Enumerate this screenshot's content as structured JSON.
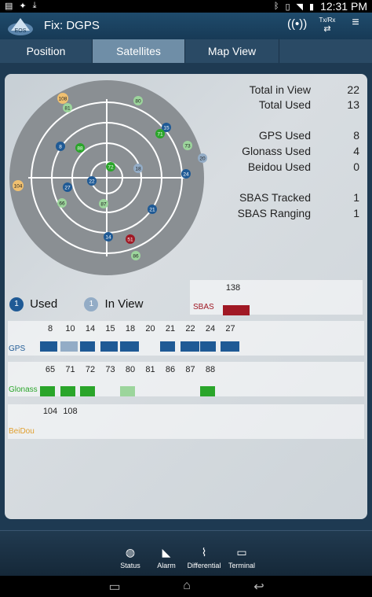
{
  "status_bar": {
    "time": "12:31 PM",
    "icons": [
      "notification-icon",
      "satellite-icon",
      "download-icon",
      "bluetooth-icon",
      "vibrate-icon",
      "wifi-icon",
      "battery-icon"
    ]
  },
  "action_bar": {
    "title": "Fix: DGPS",
    "txrx_label": "Tx/Rx",
    "icons": [
      "app-logo",
      "signal-icon",
      "txrx-icon",
      "overflow-menu-icon"
    ]
  },
  "tabs": [
    {
      "label": "Position",
      "active": false
    },
    {
      "label": "Satellites",
      "active": true
    },
    {
      "label": "Map View",
      "active": false
    }
  ],
  "stats": {
    "total_in_view": {
      "label": "Total in View",
      "value": "22"
    },
    "total_used": {
      "label": "Total Used",
      "value": "13"
    },
    "gps_used": {
      "label": "GPS Used",
      "value": "8"
    },
    "glonass_used": {
      "label": "Glonass Used",
      "value": "4"
    },
    "beidou_used": {
      "label": "Beidou Used",
      "value": "0"
    },
    "sbas_tracked": {
      "label": "SBAS Tracked",
      "value": "1"
    },
    "sbas_ranging": {
      "label": "SBAS Ranging",
      "value": "1"
    }
  },
  "legend": {
    "used_badge": "1",
    "used_label": "Used",
    "inview_badge": "1",
    "inview_label": "In View"
  },
  "colors": {
    "gps_used": "#1f5a95",
    "gps_inview": "#93acc6",
    "glonass_used": "#2aa52a",
    "glonass_inview": "#9cd59c",
    "beidou": "#e0a030",
    "sbas": "#a01824"
  },
  "skyplot": [
    {
      "prn": "108",
      "system": "beidou",
      "used": false
    },
    {
      "prn": "81",
      "system": "glonass",
      "used": false
    },
    {
      "prn": "80",
      "system": "glonass",
      "used": false
    },
    {
      "prn": "15",
      "system": "gps",
      "used": true
    },
    {
      "prn": "71",
      "system": "glonass",
      "used": true
    },
    {
      "prn": "73",
      "system": "glonass",
      "used": false
    },
    {
      "prn": "20",
      "system": "gps",
      "used": false
    },
    {
      "prn": "8",
      "system": "gps",
      "used": true
    },
    {
      "prn": "88",
      "system": "glonass",
      "used": true
    },
    {
      "prn": "72",
      "system": "glonass",
      "used": true
    },
    {
      "prn": "18",
      "system": "gps",
      "used": false
    },
    {
      "prn": "24",
      "system": "gps",
      "used": true
    },
    {
      "prn": "104",
      "system": "beidou",
      "used": false
    },
    {
      "prn": "27",
      "system": "gps",
      "used": true
    },
    {
      "prn": "22",
      "system": "gps",
      "used": true
    },
    {
      "prn": "66",
      "system": "glonass",
      "used": false
    },
    {
      "prn": "87",
      "system": "glonass",
      "used": false
    },
    {
      "prn": "21",
      "system": "gps",
      "used": true
    },
    {
      "prn": "14",
      "system": "gps",
      "used": true
    },
    {
      "prn": "51",
      "system": "sbas",
      "used": true
    },
    {
      "prn": "86",
      "system": "glonass",
      "used": false
    }
  ],
  "signals": {
    "sbas": {
      "label": "SBAS",
      "prns": [
        {
          "prn": "138",
          "level": 0.6,
          "used": true
        }
      ]
    },
    "gps": {
      "label": "GPS",
      "prns": [
        {
          "prn": "8",
          "level": 0.75,
          "used": true
        },
        {
          "prn": "10",
          "level": 0.75,
          "used": false
        },
        {
          "prn": "14",
          "level": 0.6,
          "used": true
        },
        {
          "prn": "15",
          "level": 0.75,
          "used": true
        },
        {
          "prn": "18",
          "level": 0.8,
          "used": true
        },
        {
          "prn": "20",
          "level": 0,
          "used": false
        },
        {
          "prn": "21",
          "level": 0.6,
          "used": true
        },
        {
          "prn": "22",
          "level": 0.85,
          "used": true
        },
        {
          "prn": "24",
          "level": 0.65,
          "used": true
        },
        {
          "prn": "27",
          "level": 0.85,
          "used": true
        }
      ]
    },
    "glonass": {
      "label": "Glonass",
      "prns": [
        {
          "prn": "65",
          "level": 0.6,
          "used": true
        },
        {
          "prn": "71",
          "level": 0.6,
          "used": true
        },
        {
          "prn": "72",
          "level": 0.6,
          "used": true
        },
        {
          "prn": "73",
          "level": 0,
          "used": false
        },
        {
          "prn": "80",
          "level": 0.6,
          "used": false
        },
        {
          "prn": "81",
          "level": 0,
          "used": false
        },
        {
          "prn": "86",
          "level": 0,
          "used": false
        },
        {
          "prn": "87",
          "level": 0,
          "used": false
        },
        {
          "prn": "88",
          "level": 0.6,
          "used": true
        }
      ]
    },
    "beidou": {
      "label": "BeiDou",
      "prns": [
        {
          "prn": "104",
          "level": 0,
          "used": false
        },
        {
          "prn": "108",
          "level": 0,
          "used": false
        }
      ]
    }
  },
  "bottom_nav": [
    {
      "label": "Status",
      "icon": "globe-icon"
    },
    {
      "label": "Alarm",
      "icon": "alarm-icon"
    },
    {
      "label": "Differential",
      "icon": "differential-icon"
    },
    {
      "label": "Terminal",
      "icon": "terminal-icon"
    }
  ],
  "system_nav": [
    "recent-apps-icon",
    "home-icon",
    "back-icon"
  ]
}
